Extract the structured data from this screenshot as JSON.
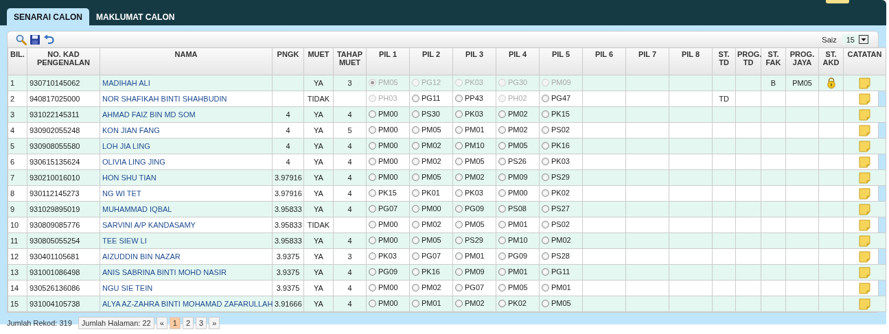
{
  "tabs": [
    {
      "label": "SENARAI CALON",
      "selected": true
    },
    {
      "label": "MAKLUMAT CALON",
      "selected": false
    }
  ],
  "toolbar": {
    "size_label": "Saiz",
    "size_value": "15"
  },
  "columns": [
    {
      "label": "BIL.",
      "kind": "bil"
    },
    {
      "label": "NO. KAD PENGENALAN",
      "kind": "ic"
    },
    {
      "label": "NAMA",
      "kind": "name"
    },
    {
      "label": "PNGK",
      "kind": "pngk"
    },
    {
      "label": "MUET",
      "kind": "muet"
    },
    {
      "label": "TAHAP MUET",
      "kind": "tahap"
    },
    {
      "label": "PIL 1",
      "kind": "choice"
    },
    {
      "label": "PIL 2",
      "kind": "choice"
    },
    {
      "label": "PIL 3",
      "kind": "choice"
    },
    {
      "label": "PIL 4",
      "kind": "choice"
    },
    {
      "label": "PIL 5",
      "kind": "choice"
    },
    {
      "label": "PIL 6",
      "kind": "choice"
    },
    {
      "label": "PIL 7",
      "kind": "choice"
    },
    {
      "label": "PIL 8",
      "kind": "choice"
    },
    {
      "label": "ST. TD",
      "kind": "st_td"
    },
    {
      "label": "PROG. TD",
      "kind": "prog_td"
    },
    {
      "label": "ST. FAK",
      "kind": "st_fak"
    },
    {
      "label": "PROG. JAYA",
      "kind": "prog_jaya"
    },
    {
      "label": "ST. AKD",
      "kind": "st_akd"
    },
    {
      "label": "CATATAN",
      "kind": "note"
    }
  ],
  "rows": [
    {
      "bil": "1",
      "ic": "930710145062",
      "name": "MADIHAH ALI",
      "muet": "YA",
      "tahap": "3",
      "choices": [
        {
          "code": "PM05",
          "selected": true,
          "disabled": true
        },
        {
          "code": "PG12",
          "selected": false,
          "disabled": true
        },
        {
          "code": "PK03",
          "selected": false,
          "disabled": true
        },
        {
          "code": "PG30",
          "selected": false,
          "disabled": true
        },
        {
          "code": "PM09",
          "selected": false,
          "disabled": true
        }
      ],
      "st_fak": "B",
      "prog_jaya": "PM05",
      "locked": true
    },
    {
      "bil": "2",
      "ic": "940817025000",
      "name": "NOR SHAFIKAH BINTI SHAHBUDIN",
      "muet": "TIDAK",
      "choices": [
        {
          "code": "PH03",
          "selected": false,
          "disabled": true
        },
        {
          "code": "PG11",
          "selected": false,
          "disabled": false
        },
        {
          "code": "PP43",
          "selected": false,
          "disabled": false
        },
        {
          "code": "PH02",
          "selected": false,
          "disabled": true
        },
        {
          "code": "PG47",
          "selected": false,
          "disabled": false
        }
      ],
      "st_td": "TD",
      "locked": false
    },
    {
      "bil": "3",
      "ic": "931022145311",
      "name": "AHMAD FAIZ BIN MD SOM",
      "pngk": "4",
      "muet": "YA",
      "tahap": "4",
      "choices": [
        {
          "code": "PM00",
          "selected": false,
          "disabled": false
        },
        {
          "code": "PS30",
          "selected": false,
          "disabled": false
        },
        {
          "code": "PK03",
          "selected": false,
          "disabled": false
        },
        {
          "code": "PM02",
          "selected": false,
          "disabled": false
        },
        {
          "code": "PK15",
          "selected": false,
          "disabled": false
        }
      ],
      "locked": false
    },
    {
      "bil": "4",
      "ic": "930902055248",
      "name": "KON JIAN FANG",
      "pngk": "4",
      "muet": "YA",
      "tahap": "5",
      "choices": [
        {
          "code": "PM00",
          "selected": false,
          "disabled": false
        },
        {
          "code": "PM05",
          "selected": false,
          "disabled": false
        },
        {
          "code": "PM01",
          "selected": false,
          "disabled": false
        },
        {
          "code": "PM02",
          "selected": false,
          "disabled": false
        },
        {
          "code": "PS02",
          "selected": false,
          "disabled": false
        }
      ],
      "locked": false
    },
    {
      "bil": "5",
      "ic": "930908055580",
      "name": "LOH JIA LING",
      "pngk": "4",
      "muet": "YA",
      "tahap": "4",
      "choices": [
        {
          "code": "PM00",
          "selected": false,
          "disabled": false
        },
        {
          "code": "PM02",
          "selected": false,
          "disabled": false
        },
        {
          "code": "PM10",
          "selected": false,
          "disabled": false
        },
        {
          "code": "PM05",
          "selected": false,
          "disabled": false
        },
        {
          "code": "PK16",
          "selected": false,
          "disabled": false
        }
      ],
      "locked": false
    },
    {
      "bil": "6",
      "ic": "930615135624",
      "name": "OLIVIA LING JING",
      "pngk": "4",
      "muet": "YA",
      "tahap": "4",
      "choices": [
        {
          "code": "PM00",
          "selected": false,
          "disabled": false
        },
        {
          "code": "PM02",
          "selected": false,
          "disabled": false
        },
        {
          "code": "PM05",
          "selected": false,
          "disabled": false
        },
        {
          "code": "PS26",
          "selected": false,
          "disabled": false
        },
        {
          "code": "PK03",
          "selected": false,
          "disabled": false
        }
      ],
      "locked": false
    },
    {
      "bil": "7",
      "ic": "930210016010",
      "name": "HON SHU TIAN",
      "pngk": "3.97916",
      "muet": "YA",
      "tahap": "4",
      "choices": [
        {
          "code": "PM00",
          "selected": false,
          "disabled": false
        },
        {
          "code": "PM05",
          "selected": false,
          "disabled": false
        },
        {
          "code": "PM02",
          "selected": false,
          "disabled": false
        },
        {
          "code": "PM09",
          "selected": false,
          "disabled": false
        },
        {
          "code": "PS29",
          "selected": false,
          "disabled": false
        }
      ],
      "locked": false
    },
    {
      "bil": "8",
      "ic": "930112145273",
      "name": "NG WI TET",
      "pngk": "3.97916",
      "muet": "YA",
      "tahap": "4",
      "choices": [
        {
          "code": "PK15",
          "selected": false,
          "disabled": false
        },
        {
          "code": "PK01",
          "selected": false,
          "disabled": false
        },
        {
          "code": "PK03",
          "selected": false,
          "disabled": false
        },
        {
          "code": "PM00",
          "selected": false,
          "disabled": false
        },
        {
          "code": "PK02",
          "selected": false,
          "disabled": false
        }
      ],
      "locked": false
    },
    {
      "bil": "9",
      "ic": "931029895019",
      "name": "MUHAMMAD IQBAL",
      "pngk": "3.95833",
      "muet": "YA",
      "tahap": "4",
      "choices": [
        {
          "code": "PG07",
          "selected": false,
          "disabled": false
        },
        {
          "code": "PM00",
          "selected": false,
          "disabled": false
        },
        {
          "code": "PG09",
          "selected": false,
          "disabled": false
        },
        {
          "code": "PS08",
          "selected": false,
          "disabled": false
        },
        {
          "code": "PS27",
          "selected": false,
          "disabled": false
        }
      ],
      "locked": false
    },
    {
      "bil": "10",
      "ic": "930809085776",
      "name": "SARVINI A/P KANDASAMY",
      "pngk": "3.95833",
      "muet": "TIDAK",
      "choices": [
        {
          "code": "PM00",
          "selected": false,
          "disabled": false
        },
        {
          "code": "PM02",
          "selected": false,
          "disabled": false
        },
        {
          "code": "PM05",
          "selected": false,
          "disabled": false
        },
        {
          "code": "PM01",
          "selected": false,
          "disabled": false
        },
        {
          "code": "PS02",
          "selected": false,
          "disabled": false
        }
      ],
      "locked": false
    },
    {
      "bil": "11",
      "ic": "930805055254",
      "name": "TEE SIEW LI",
      "pngk": "3.95833",
      "muet": "YA",
      "tahap": "4",
      "choices": [
        {
          "code": "PM00",
          "selected": false,
          "disabled": false
        },
        {
          "code": "PM05",
          "selected": false,
          "disabled": false
        },
        {
          "code": "PS29",
          "selected": false,
          "disabled": false
        },
        {
          "code": "PM10",
          "selected": false,
          "disabled": false
        },
        {
          "code": "PM02",
          "selected": false,
          "disabled": false
        }
      ],
      "locked": false
    },
    {
      "bil": "12",
      "ic": "930401105681",
      "name": "AIZUDDIN BIN NAZAR",
      "pngk": "3.9375",
      "muet": "YA",
      "tahap": "3",
      "choices": [
        {
          "code": "PK03",
          "selected": false,
          "disabled": false
        },
        {
          "code": "PG07",
          "selected": false,
          "disabled": false
        },
        {
          "code": "PM01",
          "selected": false,
          "disabled": false
        },
        {
          "code": "PG09",
          "selected": false,
          "disabled": false
        },
        {
          "code": "PS28",
          "selected": false,
          "disabled": false
        }
      ],
      "locked": false
    },
    {
      "bil": "13",
      "ic": "931001086498",
      "name": "ANIS SABRINA BINTI MOHD NASIR",
      "pngk": "3.9375",
      "muet": "YA",
      "tahap": "4",
      "choices": [
        {
          "code": "PG09",
          "selected": false,
          "disabled": false
        },
        {
          "code": "PK16",
          "selected": false,
          "disabled": false
        },
        {
          "code": "PM09",
          "selected": false,
          "disabled": false
        },
        {
          "code": "PM01",
          "selected": false,
          "disabled": false
        },
        {
          "code": "PG11",
          "selected": false,
          "disabled": false
        }
      ],
      "locked": false
    },
    {
      "bil": "14",
      "ic": "930526136086",
      "name": "NGU SIE TEIN",
      "pngk": "3.9375",
      "muet": "YA",
      "tahap": "4",
      "choices": [
        {
          "code": "PM00",
          "selected": false,
          "disabled": false
        },
        {
          "code": "PM02",
          "selected": false,
          "disabled": false
        },
        {
          "code": "PG07",
          "selected": false,
          "disabled": false
        },
        {
          "code": "PM05",
          "selected": false,
          "disabled": false
        },
        {
          "code": "PM01",
          "selected": false,
          "disabled": false
        }
      ],
      "locked": false
    },
    {
      "bil": "15",
      "ic": "931004105738",
      "name": "ALYA AZ-ZAHRA BINTI MOHAMAD ZAFARULLAH",
      "pngk": "3.91666",
      "muet": "YA",
      "tahap": "4",
      "choices": [
        {
          "code": "PM00",
          "selected": false,
          "disabled": false
        },
        {
          "code": "PM01",
          "selected": false,
          "disabled": false
        },
        {
          "code": "PM02",
          "selected": false,
          "disabled": false
        },
        {
          "code": "PK02",
          "selected": false,
          "disabled": false
        },
        {
          "code": "PM05",
          "selected": false,
          "disabled": false
        }
      ],
      "locked": false
    }
  ],
  "footer": {
    "records": "Jumlah Rekod: 319",
    "pages": "Jumlah Halaman: 22",
    "prev": "«",
    "page_links": [
      {
        "label": "1",
        "selected": true
      },
      {
        "label": "2",
        "selected": false
      },
      {
        "label": "3",
        "selected": false
      }
    ],
    "next": "»"
  }
}
